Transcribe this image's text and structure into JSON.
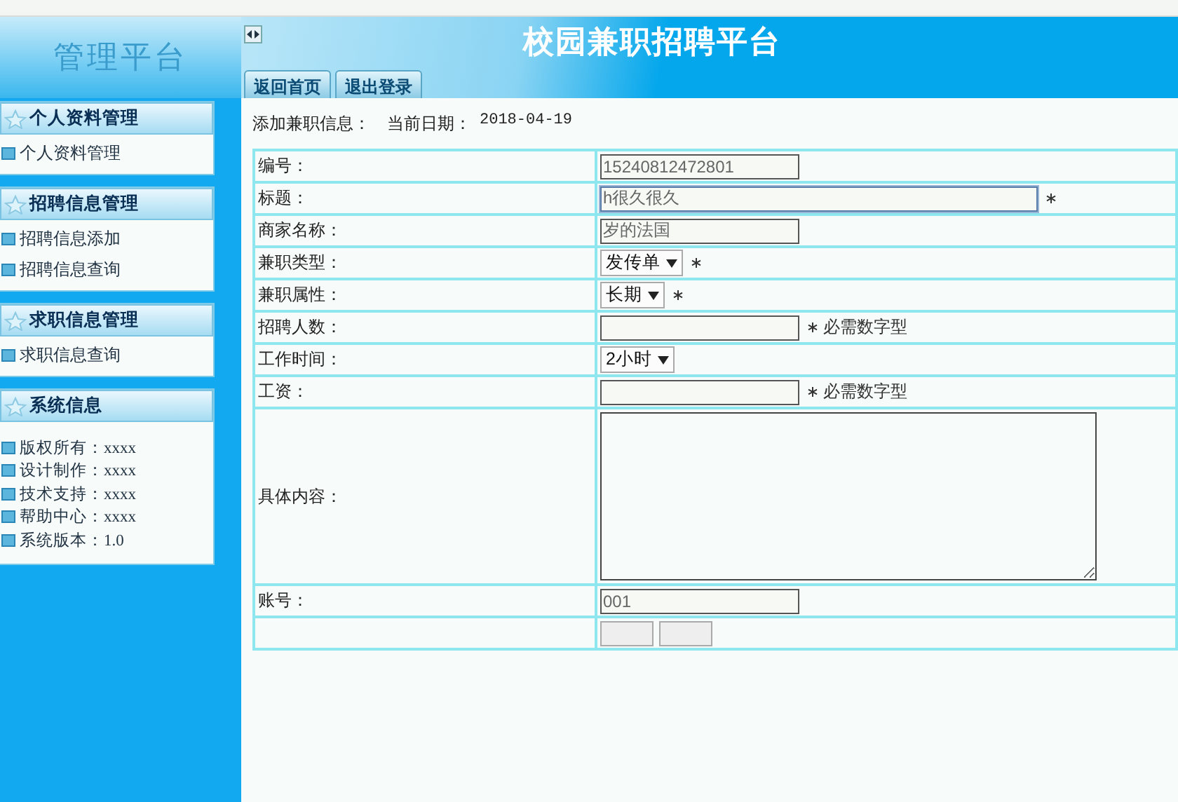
{
  "header": {
    "logo": "管理平台",
    "title": "校园兼职招聘平台",
    "tabs": [
      {
        "label": "返回首页",
        "selected": false
      },
      {
        "label": "退出登录",
        "selected": false
      }
    ]
  },
  "sidebar": [
    {
      "title": "个人资料管理",
      "kind": "menu",
      "items": [
        "个人资料管理"
      ]
    },
    {
      "title": "招聘信息管理",
      "kind": "menu",
      "items": [
        "招聘信息添加",
        "招聘信息查询"
      ]
    },
    {
      "title": "求职信息管理",
      "kind": "menu",
      "items": [
        "求职信息查询"
      ]
    },
    {
      "title": "系统信息",
      "kind": "info",
      "items": [
        "版权所有：xxxx",
        "设计制作：xxxx",
        "技术支持：xxxx",
        "帮助中心：xxxx",
        "系统版本：1.0"
      ]
    }
  ],
  "form": {
    "heading": "添加兼职信息：",
    "date_label": "当前日期：",
    "date": "2018-04-19",
    "fields": [
      {
        "label": "编号：",
        "kind": "text",
        "value": "15240812472801",
        "wide": false,
        "focused": false,
        "required": false
      },
      {
        "label": "标题：",
        "kind": "text",
        "value": "h很久很久",
        "wide": true,
        "focused": true,
        "required": true
      },
      {
        "label": "商家名称：",
        "kind": "text",
        "value": "岁的法国",
        "wide": false,
        "focused": false,
        "required": false
      },
      {
        "label": "兼职类型：",
        "kind": "select",
        "value": "发传单",
        "required": true
      },
      {
        "label": "兼职属性：",
        "kind": "select",
        "value": "长期",
        "required": true
      },
      {
        "label": "招聘人数：",
        "kind": "text",
        "wide": false,
        "focused": false,
        "required": true,
        "note": "必需数字型"
      },
      {
        "label": "工作时间：",
        "kind": "select",
        "value": "2小时",
        "required": false
      },
      {
        "label": "工资：",
        "kind": "text",
        "wide": false,
        "focused": false,
        "required": true,
        "note": "必需数字型"
      },
      {
        "label": "具体内容：",
        "kind": "textarea",
        "required": false
      },
      {
        "label": "账号：",
        "kind": "text",
        "value": "001",
        "wide": false,
        "focused": false,
        "required": false
      }
    ]
  }
}
